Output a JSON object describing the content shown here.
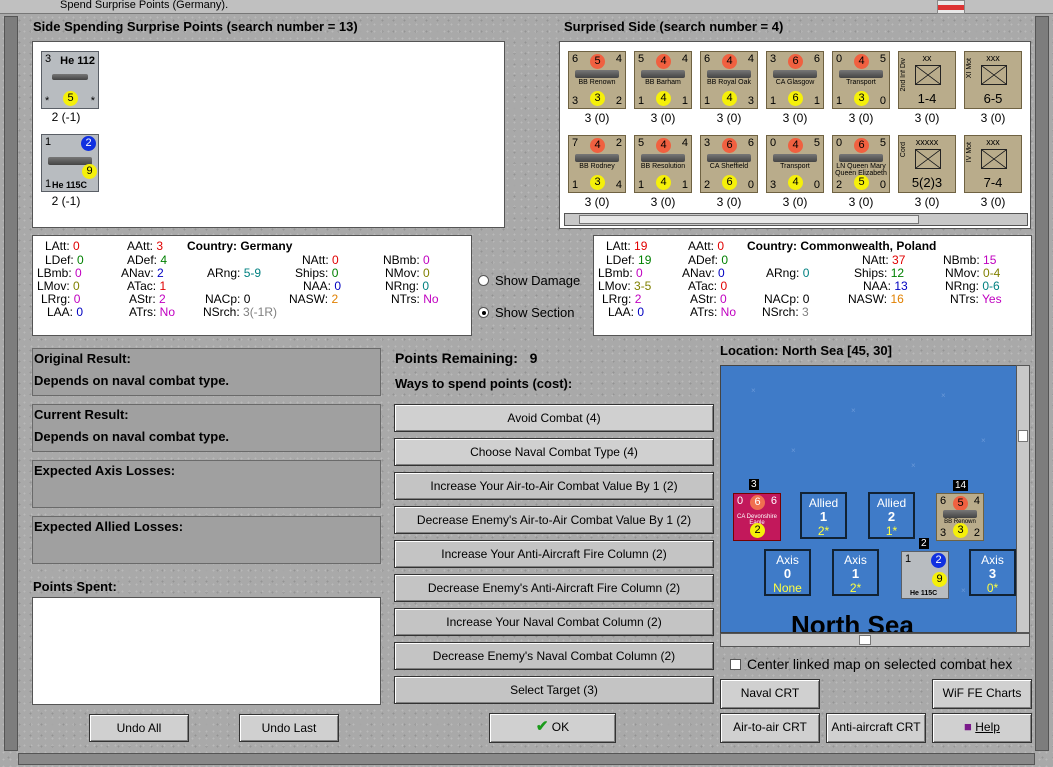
{
  "window": {
    "title": "Spend Surprise Points (Germany)."
  },
  "left_side": {
    "title": "Side Spending Surprise Points (search number = 13)",
    "units": [
      {
        "name": "He 112",
        "tl": "3",
        "tr": "*",
        "bl": "*",
        "br": "*",
        "circle": "5",
        "cost": "2 (-1)"
      },
      {
        "name": "He 115C",
        "tl": "1",
        "circle_top": "2",
        "bl": "1",
        "circle": "9",
        "cost": "2 (-1)"
      }
    ]
  },
  "right_side": {
    "title": "Surprised Side (search number = 4)",
    "units": [
      {
        "name": "BB Renown",
        "tl": "6",
        "rc": "5",
        "tr": "4",
        "bl": "3",
        "yc": "3",
        "br": "2",
        "cost": "3 (0)"
      },
      {
        "name": "BB Barham",
        "tl": "5",
        "rc": "4",
        "tr": "4",
        "bl": "1",
        "yc": "4",
        "br": "1",
        "cost": "3 (0)"
      },
      {
        "name": "BB Royal Oak",
        "tl": "6",
        "rc": "4",
        "tr": "4",
        "bl": "1",
        "yc": "4",
        "br": "3",
        "cost": "3 (0)"
      },
      {
        "name": "CA Glasgow",
        "tl": "3",
        "rc": "6",
        "tr": "6",
        "bl": "1",
        "yc": "6",
        "br": "1",
        "cost": "3 (0)"
      },
      {
        "name": "Transport",
        "tl": "0",
        "rc": "4",
        "tr": "5",
        "bl": "1",
        "yc": "3",
        "br": "0",
        "cost": "3 (0)"
      },
      {
        "name": "2nd Inf Div",
        "top": "xx",
        "big": "1-4",
        "cost": "3 (0)"
      },
      {
        "name": "XI Mot",
        "top": "xxx",
        "big": "6-5",
        "cost": "3 (0)"
      },
      {
        "name": "BB Rodney",
        "tl": "7",
        "rc": "4",
        "tr": "2",
        "bl": "1",
        "yc": "3",
        "br": "4",
        "cost": "3 (0)"
      },
      {
        "name": "BB Resolution",
        "tl": "5",
        "rc": "4",
        "tr": "4",
        "bl": "1",
        "yc": "4",
        "br": "1",
        "cost": "3 (0)"
      },
      {
        "name": "CA Sheffield",
        "tl": "3",
        "rc": "6",
        "tr": "6",
        "bl": "2",
        "yc": "6",
        "br": "0",
        "cost": "3 (0)"
      },
      {
        "name": "Transport",
        "tl": "0",
        "rc": "4",
        "tr": "5",
        "bl": "3",
        "yc": "4",
        "br": "0",
        "cost": "3 (0)"
      },
      {
        "name": "LN Queen Mary Queen Elizabeth",
        "tl": "0",
        "rc": "6",
        "tr": "5",
        "bl": "2",
        "yc": "5",
        "br": "0",
        "cost": "3 (0)"
      },
      {
        "name": "Cord",
        "top": "xxxxx",
        "big": "5(2)3",
        "cost": "3 (0)"
      },
      {
        "name": "IV Mot",
        "top": "xxx",
        "big": "7-4",
        "cost": "3 (0)"
      }
    ]
  },
  "left_stats": {
    "country_label": "Country:",
    "country": "Germany",
    "rows": [
      [
        "LAtt:",
        "0",
        "AAtt:",
        "3",
        "NAtt:",
        "0",
        "NBmb:",
        "0"
      ],
      [
        "LDef:",
        "0",
        "ADef:",
        "4",
        "NBmb:",
        "0"
      ],
      [
        "LBmb:",
        "0",
        "ANav:",
        "2",
        "ARng:",
        "5-9",
        "Ships:",
        "0",
        "NMov:",
        "0"
      ],
      [
        "LMov:",
        "0",
        "ATac:",
        "1",
        "NAA:",
        "0",
        "NRng:",
        "0"
      ],
      [
        "LRrg:",
        "0",
        "AStr:",
        "2",
        "NACp:",
        "0",
        "NASW:",
        "2",
        "NTrs:",
        "No"
      ],
      [
        "LAA:",
        "0",
        "ATrs:",
        "No",
        "NSrch:",
        "3(-1R)"
      ]
    ]
  },
  "right_stats": {
    "country_label": "Country:",
    "country": "Commonwealth, Poland",
    "LAtt": "19",
    "AAtt": "0",
    "NAtt": "37",
    "NBmb": "15",
    "LDef": "19",
    "ADef": "0",
    "LBmb": "0",
    "ANav": "0",
    "ARng": "0",
    "Ships": "12",
    "NMov": "0-4",
    "LMov": "3-5",
    "ATac": "0",
    "NAA": "13",
    "NRng": "0-6",
    "LRrg": "2",
    "AStr": "0",
    "NACp": "0",
    "NASW": "16",
    "NTrs": "Yes",
    "LAA": "0",
    "ATrs": "No",
    "NSrch": "3"
  },
  "radios": {
    "show_damage": "Show Damage",
    "show_section": "Show Section"
  },
  "results": {
    "original_label": "Original Result:",
    "original_value": "Depends on naval combat type.",
    "current_label": "Current Result:",
    "current_value": "Depends on naval combat type.",
    "axis_losses_label": "Expected Axis Losses:",
    "allied_losses_label": "Expected Allied Losses:",
    "points_spent_label": "Points Spent:"
  },
  "points": {
    "remaining_label": "Points Remaining:",
    "remaining_value": "9",
    "ways_label": "Ways to spend points (cost):"
  },
  "options": [
    "Avoid Combat (4)",
    "Choose Naval Combat Type (4)",
    "Increase Your Air-to-Air Combat Value By 1 (2)",
    "Decrease Enemy's Air-to-Air Combat Value By 1 (2)",
    "Increase Your Anti-Aircraft Fire Column (2)",
    "Decrease Enemy's Anti-Aircraft Fire Column (2)",
    "Increase Your Naval Combat Column (2)",
    "Decrease Enemy's Naval Combat Column (2)",
    "Select Target (3)"
  ],
  "bottom": {
    "undo_all": "Undo All",
    "undo_last": "Undo Last",
    "ok": "OK"
  },
  "location": {
    "label": "Location: North Sea [45, 30]",
    "map_name": "North Sea",
    "boxes": [
      {
        "top": "Allied",
        "n": "1",
        "v": "2*"
      },
      {
        "top": "Allied",
        "n": "2",
        "v": "1*"
      },
      {
        "top": "Axis",
        "n": "0",
        "v": "None"
      },
      {
        "top": "Axis",
        "n": "1",
        "v": "2*"
      },
      {
        "top": "Axis",
        "n": "3",
        "v": "0*"
      }
    ],
    "stack_counts": [
      "3",
      "14",
      "2"
    ],
    "map_counters": {
      "ca": "CA Devonshire Eagle",
      "bb": "BB Renown",
      "he": "He 115C"
    }
  },
  "center_linked": "Center linked map on selected combat hex",
  "crt_buttons": {
    "naval": "Naval CRT",
    "wif": "WiF FE Charts",
    "air": "Air-to-air CRT",
    "aa": "Anti-aircraft CRT",
    "help": "Help"
  },
  "colors": {
    "panel_gray": "#a0a0a0",
    "sea": "#3f7bc8",
    "counter_tan": "#b9ac8b"
  }
}
